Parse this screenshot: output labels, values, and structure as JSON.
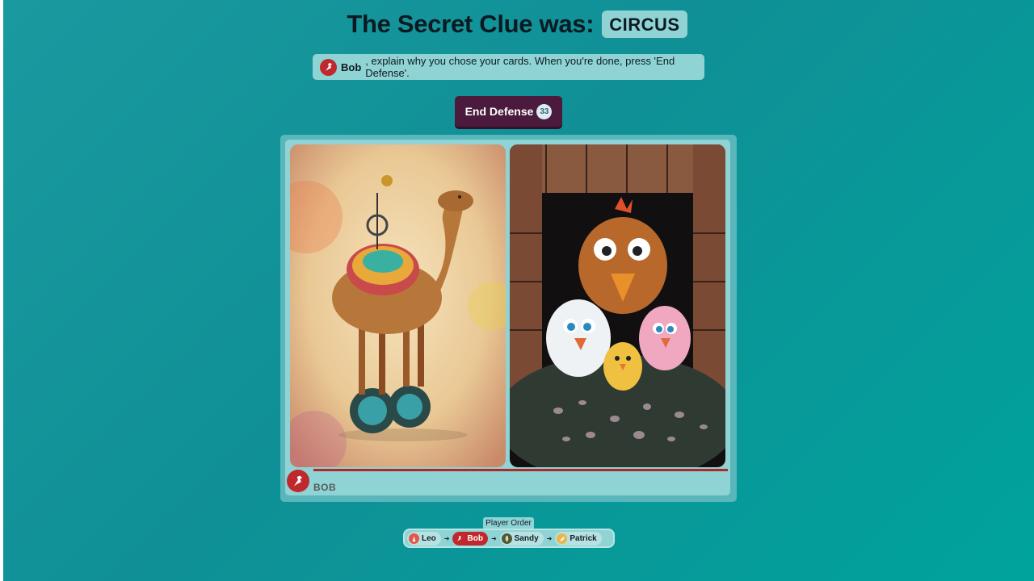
{
  "header": {
    "title": "The Secret Clue was:",
    "clue": "CIRCUS"
  },
  "instruction": {
    "player_name": "Bob",
    "text": ", explain why you chose your cards. When you're done, press 'End Defense'."
  },
  "end_defense": {
    "label": "End Defense",
    "timer": "33"
  },
  "board": {
    "cards": [
      {
        "subject": "camel balancing on a unicycle"
      },
      {
        "subject": "cartoon chickens in a stone cave"
      }
    ],
    "owner": "BOB",
    "owner_color": "#c0282d"
  },
  "player_order": {
    "label": "Player Order",
    "players": [
      {
        "name": "Leo",
        "color": "#e05a4a",
        "active": false
      },
      {
        "name": "Bob",
        "color": "#c0282d",
        "active": true
      },
      {
        "name": "Sandy",
        "color": "#4a5a3a",
        "active": false
      },
      {
        "name": "Patrick",
        "color": "#e8b84a",
        "active": false
      }
    ]
  },
  "colors": {
    "background": "#0f9096",
    "panel": "#8fd3d4",
    "button": "#4b1a3c"
  }
}
